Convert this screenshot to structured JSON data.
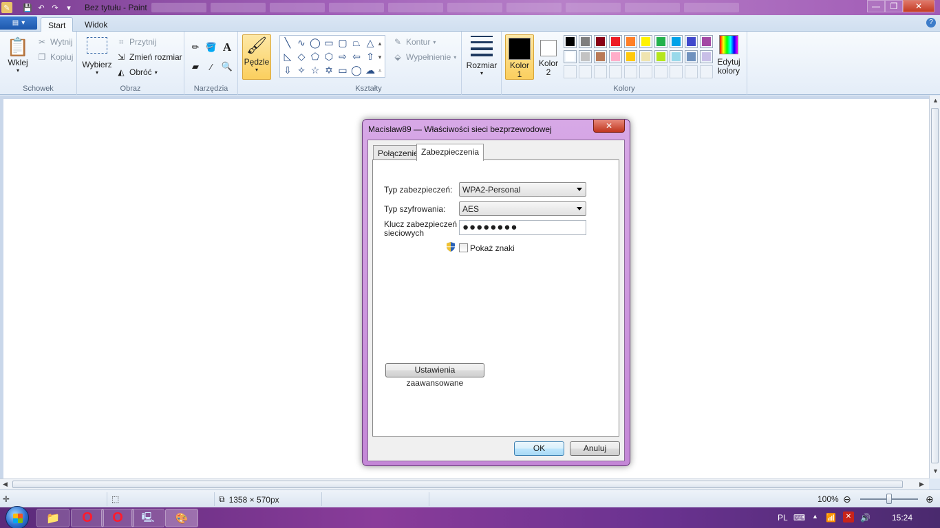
{
  "window": {
    "title": "Bez tytułu - Paint",
    "controls": {
      "minimize": "—",
      "maximize": "❐",
      "close": "✕"
    }
  },
  "ribbon": {
    "tabs": [
      "Start",
      "Widok"
    ],
    "groups": {
      "schowek": {
        "label": "Schowek",
        "paste": "Wklej",
        "cut": "Wytnij",
        "copy": "Kopiuj"
      },
      "obraz": {
        "label": "Obraz",
        "select": "Wybierz",
        "crop": "Przytnij",
        "resize": "Zmień rozmiar",
        "rotate": "Obróć"
      },
      "narzedzia": {
        "label": "Narzędzia"
      },
      "pedzle": {
        "label": "Pędzle"
      },
      "ksztalty": {
        "label": "Kształty",
        "outline": "Kontur",
        "fill": "Wypełnienie"
      },
      "rozmiar": {
        "label": "Rozmiar"
      },
      "kolory": {
        "label": "Kolory",
        "color1": "Kolor 1",
        "color2": "Kolor 2",
        "edit": "Edytuj kolory"
      }
    },
    "palette_row1": [
      "#000000",
      "#7f7f7f",
      "#880015",
      "#ed1c24",
      "#ff7f27",
      "#fff200",
      "#22b14c",
      "#00a2e8",
      "#3f48cc",
      "#a349a4"
    ],
    "palette_row2": [
      "#ffffff",
      "#c3c3c3",
      "#b97a57",
      "#ffaec9",
      "#ffc90e",
      "#efe4b0",
      "#b5e61d",
      "#99d9ea",
      "#7092be",
      "#c8bfe7"
    ]
  },
  "statusbar": {
    "dimensions": "1358 × 570px",
    "zoom": "100%"
  },
  "taskbar": {
    "language": "PL",
    "time": "15:24"
  },
  "dialog": {
    "title": "Macislaw89 — Właściwości sieci bezprzewodowej",
    "tabs": [
      "Połączenie",
      "Zabezpieczenia"
    ],
    "security_type_label": "Typ zabezpieczeń:",
    "security_type_value": "WPA2-Personal",
    "encryption_type_label": "Typ szyfrowania:",
    "encryption_type_value": "AES",
    "key_label_line1": "Klucz zabezpieczeń",
    "key_label_line2": "sieciowych",
    "key_value": "●●●●●●●●",
    "show_chars_label": "Pokaż znaki",
    "advanced_button": "Ustawienia zaawansowane",
    "ok_button": "OK",
    "cancel_button": "Anuluj"
  }
}
